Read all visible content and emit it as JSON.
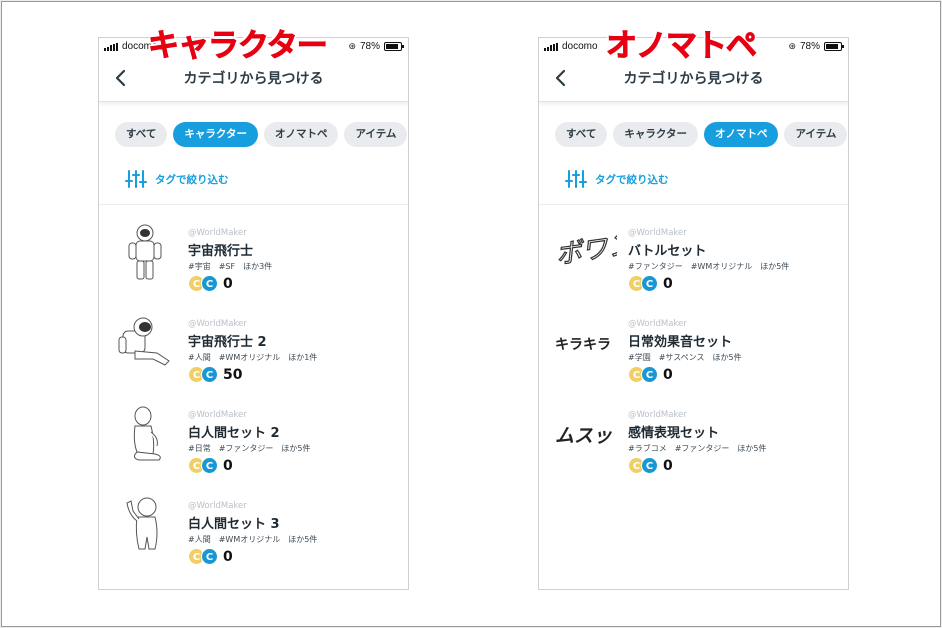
{
  "captions": {
    "left": "キャラクター",
    "right": "オノマトペ"
  },
  "accent_color": "#169ede",
  "phones": [
    {
      "status": {
        "carrier": "docomo",
        "battery": "78%",
        "battery_level": 0.78,
        "lock_icon": "orientation-lock-icon"
      },
      "nav_title": "カテゴリから見つける",
      "chips": [
        "すべて",
        "キャラクター",
        "オノマトペ",
        "アイテム"
      ],
      "active_chip": "キャラクター",
      "filter_label": "タグで絞り込む",
      "items": [
        {
          "author": "@WorldMaker",
          "title": "宇宙飛行士",
          "tags": "#宇宙　#SF　ほか3件",
          "price": "0",
          "thumb": "astronaut-standing"
        },
        {
          "author": "@WorldMaker",
          "title": "宇宙飛行士 2",
          "tags": "#人間　#WMオリジナル　ほか1件",
          "price": "50",
          "thumb": "astronaut-sitting"
        },
        {
          "author": "@WorldMaker",
          "title": "白人間セット 2",
          "tags": "#日常　#ファンタジー　ほか5件",
          "price": "0",
          "thumb": "white-figure-sitting"
        },
        {
          "author": "@WorldMaker",
          "title": "白人間セット 3",
          "tags": "#人間　#WMオリジナル　ほか5件",
          "price": "0",
          "thumb": "white-figure-waving"
        }
      ]
    },
    {
      "status": {
        "carrier": "docomo",
        "battery": "78%",
        "battery_level": 0.78,
        "lock_icon": "orientation-lock-icon"
      },
      "nav_title": "カテゴリから見つける",
      "chips": [
        "すべて",
        "キャラクター",
        "オノマトペ",
        "アイテム"
      ],
      "active_chip": "オノマトペ",
      "filter_label": "タグで絞り込む",
      "items": [
        {
          "author": "@WorldMaker",
          "title": "バトルセット",
          "tags": "#ファンタジー　#WMオリジナル　ほか5件",
          "price": "0",
          "thumb_text": "ボワン"
        },
        {
          "author": "@WorldMaker",
          "title": "日常効果音セット",
          "tags": "#学園　#サスペンス　ほか5件",
          "price": "0",
          "thumb_text": "キラキラ"
        },
        {
          "author": "@WorldMaker",
          "title": "感情表現セット",
          "tags": "#ラブコメ　#ファンタジー　ほか5件",
          "price": "0",
          "thumb_text": "ムスッ"
        }
      ]
    }
  ],
  "coin_labels": {
    "gold": "C",
    "blue": "C"
  }
}
